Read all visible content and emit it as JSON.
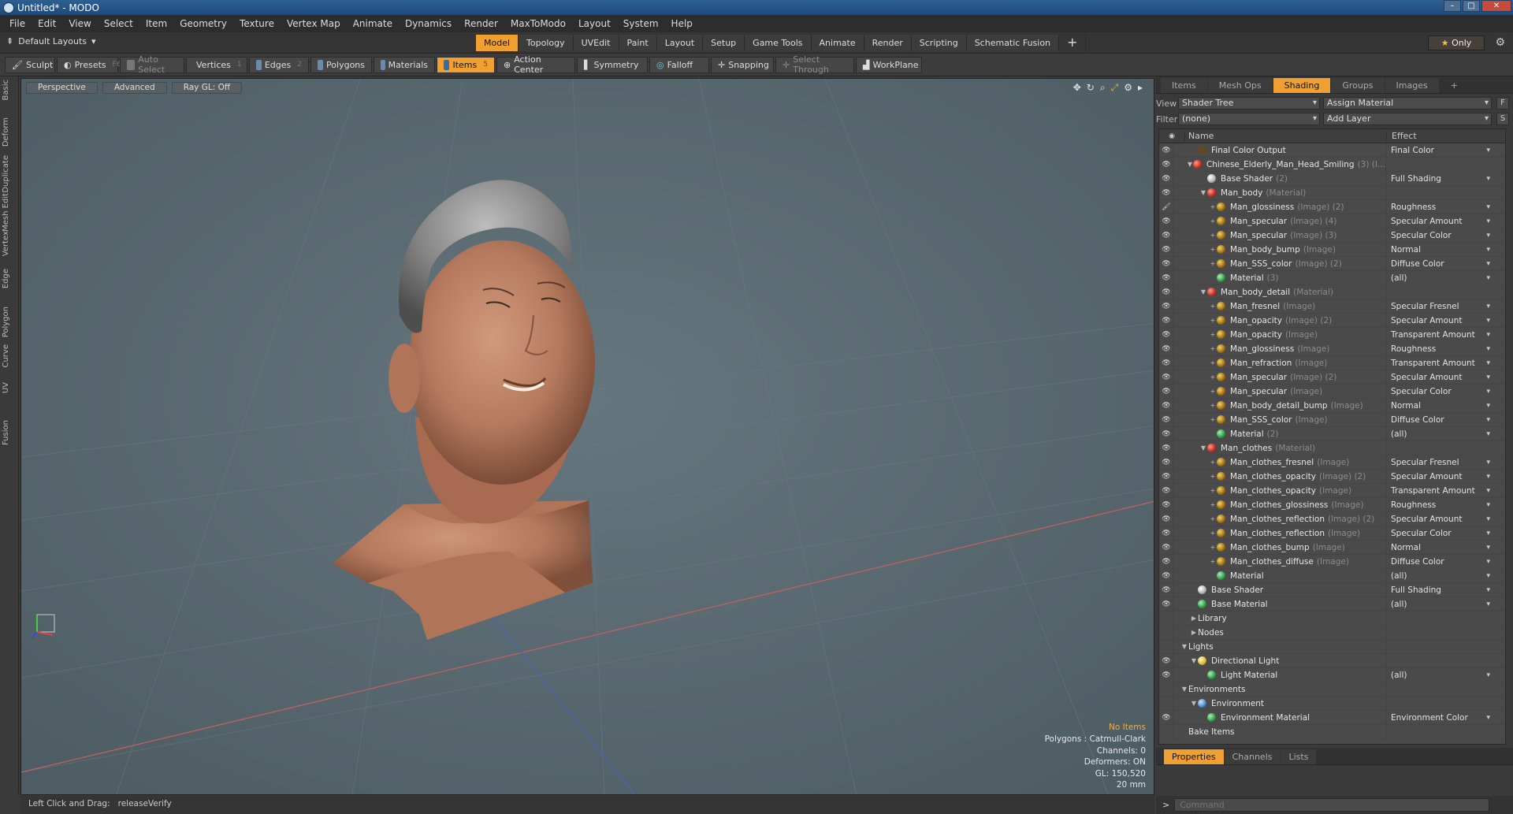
{
  "window": {
    "title": "Untitled* - MODO"
  },
  "menu": [
    "File",
    "Edit",
    "View",
    "Select",
    "Item",
    "Geometry",
    "Texture",
    "Vertex Map",
    "Animate",
    "Dynamics",
    "Render",
    "MaxToModo",
    "Layout",
    "System",
    "Help"
  ],
  "layout_bar": {
    "layout_select": "Default Layouts",
    "tabs": [
      "Model",
      "Topology",
      "UVEdit",
      "Paint",
      "Layout",
      "Setup",
      "Game Tools",
      "Animate",
      "Render",
      "Scripting",
      "Schematic Fusion"
    ],
    "active_tab": "Model",
    "add_tab": "+",
    "only_label": "Only"
  },
  "toolbar": {
    "sculpt": "Sculpt",
    "presets": "Presets",
    "presets_key": "F6",
    "auto_select": "Auto Select",
    "vertices": "Vertices",
    "vertices_num": "1",
    "edges": "Edges",
    "edges_num": "2",
    "polygons": "Polygons",
    "materials": "Materials",
    "items": "Items",
    "items_num": "5",
    "action_center": "Action Center",
    "symmetry": "Symmetry",
    "falloff": "Falloff",
    "snapping": "Snapping",
    "select_through": "Select Through",
    "workplane": "WorkPlane"
  },
  "left_tabs": [
    "Basic",
    "Deform",
    "Duplicate",
    "Mesh Edit",
    "Vertex",
    "Edge",
    "Polygon",
    "Curve",
    "UV",
    "Fusion"
  ],
  "viewport": {
    "view_mode": "Perspective",
    "shading": "Advanced",
    "raygl": "Ray GL: Off",
    "info": {
      "no_items": "No Items",
      "polygons": "Polygons : Catmull-Clark",
      "channels": "Channels: 0",
      "deformers": "Deformers: ON",
      "gl": "GL: 150,520",
      "scale": "20 mm"
    }
  },
  "status": {
    "hint": "Left Click and Drag:",
    "action": "releaseVerify"
  },
  "right_panel": {
    "tabs": [
      "Items",
      "Mesh Ops",
      "Shading",
      "Groups",
      "Images"
    ],
    "active_tab": "Shading",
    "add_tab": "+",
    "view_label": "View",
    "view_value": "Shader Tree",
    "assign_material": "Assign Material",
    "f_btn": "F",
    "filter_label": "Filter",
    "filter_value": "(none)",
    "add_layer": "Add Layer",
    "s_btn": "S",
    "col_name": "Name",
    "col_effect": "Effect",
    "tree": [
      {
        "depth": 1,
        "node": "out",
        "name": "Final Color Output",
        "type": "",
        "effect": "Final Color",
        "eye": true
      },
      {
        "depth": 1,
        "node": "mat-red",
        "name": "Chinese_Elderly_Man_Head_Smiling",
        "type": "(3) (I...",
        "effect": "",
        "eye": true,
        "tw": "▼"
      },
      {
        "depth": 2,
        "node": "shader",
        "name": "Base Shader",
        "type": "(2)",
        "effect": "Full Shading",
        "eye": true
      },
      {
        "depth": 2,
        "node": "mat-red",
        "name": "Man_body",
        "type": "(Material)",
        "effect": "",
        "eye": true,
        "tw": "▼"
      },
      {
        "depth": 3,
        "node": "img",
        "name": "Man_glossiness",
        "type": "(Image) (2)",
        "effect": "Roughness",
        "eye": "brush",
        "plus": true
      },
      {
        "depth": 3,
        "node": "img",
        "name": "Man_specular",
        "type": "(Image) (4)",
        "effect": "Specular Amount",
        "eye": true,
        "plus": true
      },
      {
        "depth": 3,
        "node": "img",
        "name": "Man_specular",
        "type": "(Image) (3)",
        "effect": "Specular Color",
        "eye": true,
        "plus": true
      },
      {
        "depth": 3,
        "node": "img",
        "name": "Man_body_bump",
        "type": "(Image)",
        "effect": "Normal",
        "eye": true,
        "plus": true
      },
      {
        "depth": 3,
        "node": "img",
        "name": "Man_SSS_color",
        "type": "(Image) (2)",
        "effect": "Diffuse Color",
        "eye": true,
        "plus": true
      },
      {
        "depth": 3,
        "node": "mat-green",
        "name": "Material",
        "type": "(3)",
        "effect": "(all)",
        "eye": true
      },
      {
        "depth": 2,
        "node": "mat-red",
        "name": "Man_body_detail",
        "type": "(Material)",
        "effect": "",
        "eye": true,
        "tw": "▼"
      },
      {
        "depth": 3,
        "node": "img",
        "name": "Man_fresnel",
        "type": "(Image)",
        "effect": "Specular Fresnel",
        "eye": true,
        "plus": true
      },
      {
        "depth": 3,
        "node": "img",
        "name": "Man_opacity",
        "type": "(Image) (2)",
        "effect": "Specular Amount",
        "eye": true,
        "plus": true
      },
      {
        "depth": 3,
        "node": "img",
        "name": "Man_opacity",
        "type": "(Image)",
        "effect": "Transparent Amount",
        "eye": true,
        "plus": true
      },
      {
        "depth": 3,
        "node": "img",
        "name": "Man_glossiness",
        "type": "(Image)",
        "effect": "Roughness",
        "eye": true,
        "plus": true
      },
      {
        "depth": 3,
        "node": "img",
        "name": "Man_refraction",
        "type": "(Image)",
        "effect": "Transparent Amount",
        "eye": true,
        "plus": true
      },
      {
        "depth": 3,
        "node": "img",
        "name": "Man_specular",
        "type": "(Image) (2)",
        "effect": "Specular Amount",
        "eye": true,
        "plus": true
      },
      {
        "depth": 3,
        "node": "img",
        "name": "Man_specular",
        "type": "(Image)",
        "effect": "Specular Color",
        "eye": true,
        "plus": true
      },
      {
        "depth": 3,
        "node": "img",
        "name": "Man_body_detail_bump",
        "type": "(Image)",
        "effect": "Normal",
        "eye": true,
        "plus": true
      },
      {
        "depth": 3,
        "node": "img",
        "name": "Man_SSS_color",
        "type": "(Image)",
        "effect": "Diffuse Color",
        "eye": true,
        "plus": true
      },
      {
        "depth": 3,
        "node": "mat-green",
        "name": "Material",
        "type": "(2)",
        "effect": "(all)",
        "eye": true
      },
      {
        "depth": 2,
        "node": "mat-red",
        "name": "Man_clothes",
        "type": "(Material)",
        "effect": "",
        "eye": true,
        "tw": "▼"
      },
      {
        "depth": 3,
        "node": "img",
        "name": "Man_clothes_fresnel",
        "type": "(Image)",
        "effect": "Specular Fresnel",
        "eye": true,
        "plus": true
      },
      {
        "depth": 3,
        "node": "img",
        "name": "Man_clothes_opacity",
        "type": "(Image) (2)",
        "effect": "Specular Amount",
        "eye": true,
        "plus": true
      },
      {
        "depth": 3,
        "node": "img",
        "name": "Man_clothes_opacity",
        "type": "(Image)",
        "effect": "Transparent Amount",
        "eye": true,
        "plus": true
      },
      {
        "depth": 3,
        "node": "img",
        "name": "Man_clothes_glossiness",
        "type": "(Image)",
        "effect": "Roughness",
        "eye": true,
        "plus": true
      },
      {
        "depth": 3,
        "node": "img",
        "name": "Man_clothes_reflection",
        "type": "(Image) (2)",
        "effect": "Specular Amount",
        "eye": true,
        "plus": true
      },
      {
        "depth": 3,
        "node": "img",
        "name": "Man_clothes_reflection",
        "type": "(Image)",
        "effect": "Specular Color",
        "eye": true,
        "plus": true
      },
      {
        "depth": 3,
        "node": "img",
        "name": "Man_clothes_bump",
        "type": "(Image)",
        "effect": "Normal",
        "eye": true,
        "plus": true
      },
      {
        "depth": 3,
        "node": "img",
        "name": "Man_clothes_diffuse",
        "type": "(Image)",
        "effect": "Diffuse Color",
        "eye": true,
        "plus": true
      },
      {
        "depth": 3,
        "node": "mat-green",
        "name": "Material",
        "type": "",
        "effect": "(all)",
        "eye": true
      },
      {
        "depth": 1,
        "node": "shader",
        "name": "Base Shader",
        "type": "",
        "effect": "Full Shading",
        "eye": true
      },
      {
        "depth": 1,
        "node": "mat-green",
        "name": "Base Material",
        "type": "",
        "effect": "(all)",
        "eye": true
      },
      {
        "depth": 1,
        "node": "folder",
        "name": "Library",
        "type": "",
        "effect": "",
        "eye": false,
        "tw": "▶"
      },
      {
        "depth": 1,
        "node": "folder",
        "name": "Nodes",
        "type": "",
        "effect": "",
        "eye": false,
        "tw": "▶"
      },
      {
        "depth": 0,
        "node": "folder",
        "name": "Lights",
        "type": "",
        "effect": "",
        "eye": false,
        "tw": "▼"
      },
      {
        "depth": 1,
        "node": "light",
        "name": "Directional Light",
        "type": "",
        "effect": "",
        "eye": true,
        "tw": "▼"
      },
      {
        "depth": 2,
        "node": "mat-green",
        "name": "Light Material",
        "type": "",
        "effect": "(all)",
        "eye": true
      },
      {
        "depth": 0,
        "node": "folder",
        "name": "Environments",
        "type": "",
        "effect": "",
        "eye": false,
        "tw": "▼"
      },
      {
        "depth": 1,
        "node": "env",
        "name": "Environment",
        "type": "",
        "effect": "",
        "eye": false,
        "tw": "▼"
      },
      {
        "depth": 2,
        "node": "mat-green",
        "name": "Environment Material",
        "type": "",
        "effect": "Environment Color",
        "eye": true
      },
      {
        "depth": 0,
        "node": "folder",
        "name": "Bake Items",
        "type": "",
        "effect": "",
        "eye": false
      }
    ],
    "bottom_tabs": [
      "Properties",
      "Channels",
      "Lists"
    ],
    "bottom_active": "Properties",
    "command_placeholder": "Command",
    "cmd_prompt": ">"
  },
  "colors": {
    "accent": "#f0a030",
    "viewport_bg": "#5b6b73",
    "skin": "#b57a5e",
    "hair": "#8a8a8a"
  }
}
